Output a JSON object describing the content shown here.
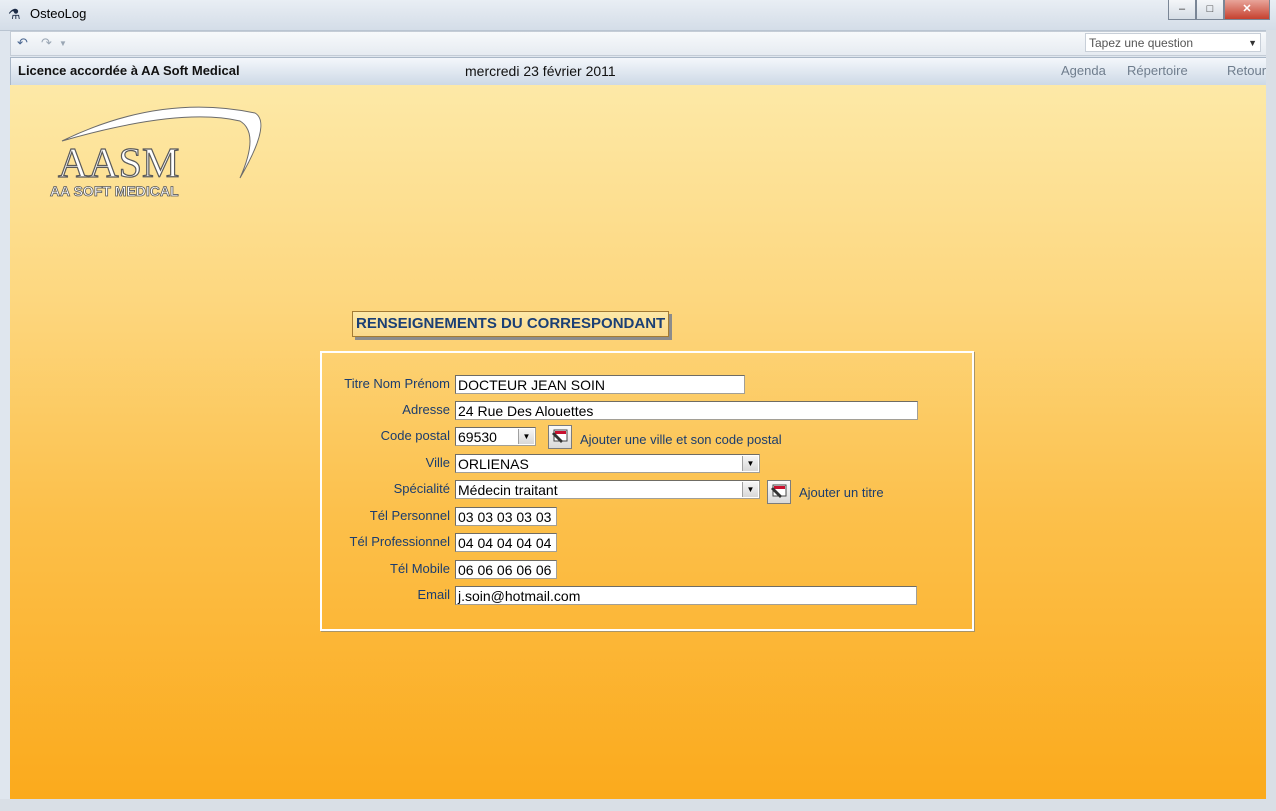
{
  "window": {
    "title": "OsteoLog"
  },
  "toolbar": {
    "question_placeholder": "Tapez une question"
  },
  "header": {
    "license": "Licence accordée à AA Soft Medical",
    "date": "mercredi 23 février 2011",
    "nav": [
      "Agenda",
      "Répertoire",
      "Retour"
    ]
  },
  "logo": {
    "main": "AASM",
    "sub": "AA SOFT MEDICAL"
  },
  "form": {
    "title": "RENSEIGNEMENTS DU CORRESPONDANT",
    "fields": {
      "titre_nom_prenom": {
        "label": "Titre Nom Prénom",
        "value": "DOCTEUR JEAN SOIN"
      },
      "adresse": {
        "label": "Adresse",
        "value": "24 Rue Des Alouettes"
      },
      "code_postal": {
        "label": "Code postal",
        "value": "69530"
      },
      "ville": {
        "label": "Ville",
        "value": "ORLIENAS"
      },
      "specialite": {
        "label": "Spécialité",
        "value": "Médecin traitant"
      },
      "tel_personnel": {
        "label": "Tél Personnel",
        "value": "03 03 03 03 03"
      },
      "tel_professionnel": {
        "label": "Tél Professionnel",
        "value": "04 04 04 04 04"
      },
      "tel_mobile": {
        "label": "Tél Mobile",
        "value": "06 06 06 06 06"
      },
      "email": {
        "label": "Email",
        "value": "j.soin@hotmail.com"
      }
    },
    "add_city_label": "Ajouter une ville et son code postal",
    "add_title_label": "Ajouter un titre"
  }
}
